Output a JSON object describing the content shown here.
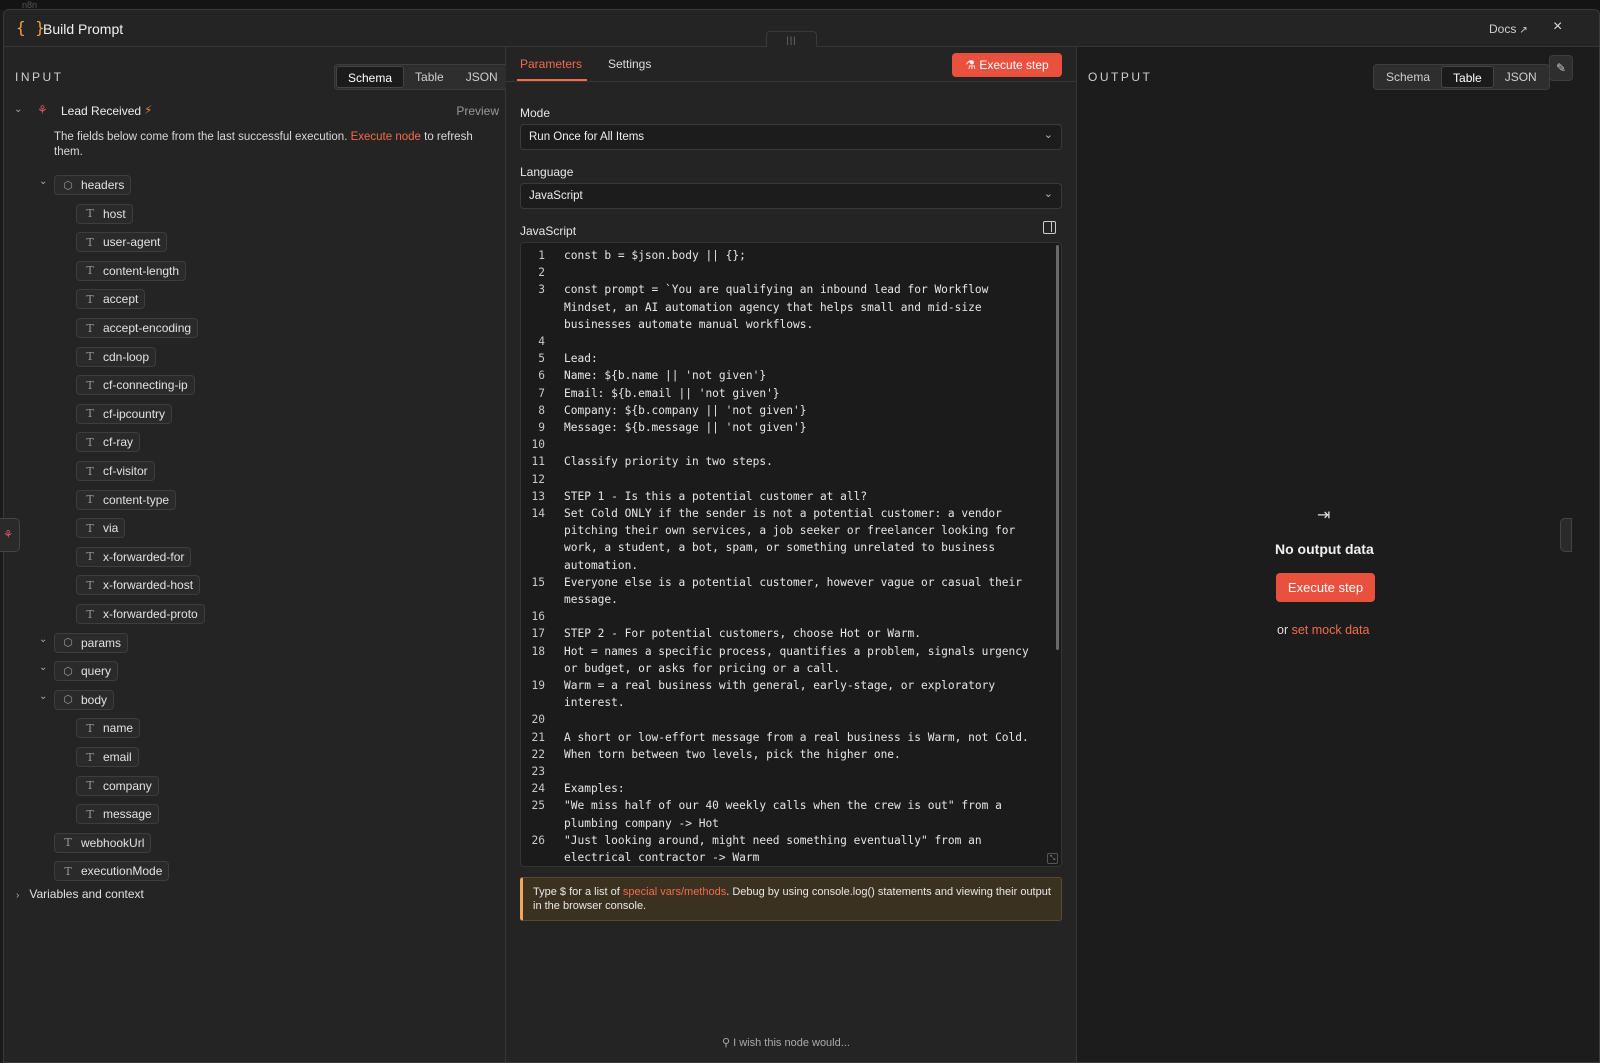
{
  "header": {
    "title": "Build Prompt",
    "docs_label": "Docs",
    "close": "×",
    "drag": "|||"
  },
  "input_panel": {
    "label": "INPUT",
    "views": [
      "Schema",
      "Table",
      "JSON"
    ],
    "active_view": "Schema",
    "node_name": "Lead Received",
    "preview": "Preview",
    "notice_pre": "The fields below come from the last successful execution.",
    "notice_link": "Execute node",
    "notice_post": "to refresh them.",
    "fields": [
      {
        "label": "headers",
        "type": "object",
        "depth": 1,
        "expanded": true
      },
      {
        "label": "host",
        "type": "text",
        "depth": 2
      },
      {
        "label": "user-agent",
        "type": "text",
        "depth": 2
      },
      {
        "label": "content-length",
        "type": "text",
        "depth": 2
      },
      {
        "label": "accept",
        "type": "text",
        "depth": 2
      },
      {
        "label": "accept-encoding",
        "type": "text",
        "depth": 2
      },
      {
        "label": "cdn-loop",
        "type": "text",
        "depth": 2
      },
      {
        "label": "cf-connecting-ip",
        "type": "text",
        "depth": 2
      },
      {
        "label": "cf-ipcountry",
        "type": "text",
        "depth": 2
      },
      {
        "label": "cf-ray",
        "type": "text",
        "depth": 2
      },
      {
        "label": "cf-visitor",
        "type": "text",
        "depth": 2
      },
      {
        "label": "content-type",
        "type": "text",
        "depth": 2
      },
      {
        "label": "via",
        "type": "text",
        "depth": 2
      },
      {
        "label": "x-forwarded-for",
        "type": "text",
        "depth": 2
      },
      {
        "label": "x-forwarded-host",
        "type": "text",
        "depth": 2
      },
      {
        "label": "x-forwarded-proto",
        "type": "text",
        "depth": 2
      },
      {
        "label": "params",
        "type": "object",
        "depth": 1,
        "expanded": true
      },
      {
        "label": "query",
        "type": "object",
        "depth": 1,
        "expanded": true
      },
      {
        "label": "body",
        "type": "object",
        "depth": 1,
        "expanded": true
      },
      {
        "label": "name",
        "type": "text",
        "depth": 2
      },
      {
        "label": "email",
        "type": "text",
        "depth": 2
      },
      {
        "label": "company",
        "type": "text",
        "depth": 2
      },
      {
        "label": "message",
        "type": "text",
        "depth": 2
      },
      {
        "label": "webhookUrl",
        "type": "text",
        "depth": 1
      },
      {
        "label": "executionMode",
        "type": "text",
        "depth": 1
      }
    ],
    "variables_label": "Variables and context"
  },
  "params_panel": {
    "tabs": [
      "Parameters",
      "Settings"
    ],
    "active_tab": "Parameters",
    "execute_label": "Execute step",
    "mode_label": "Mode",
    "mode_value": "Run Once for All Items",
    "language_label": "Language",
    "language_value": "JavaScript",
    "code_label": "JavaScript",
    "code_lines": [
      {
        "n": "1",
        "text": "const b = $json.body || {};"
      },
      {
        "n": "2",
        "text": ""
      },
      {
        "n": "3",
        "text": "const prompt = `You are qualifying an inbound lead for Workflow"
      },
      {
        "n": "",
        "text": "Mindset, an AI automation agency that helps small and mid-size"
      },
      {
        "n": "",
        "text": "businesses automate manual workflows."
      },
      {
        "n": "4",
        "text": ""
      },
      {
        "n": "5",
        "text": "Lead:"
      },
      {
        "n": "6",
        "text": "Name: ${b.name || 'not given'}"
      },
      {
        "n": "7",
        "text": "Email: ${b.email || 'not given'}"
      },
      {
        "n": "8",
        "text": "Company: ${b.company || 'not given'}"
      },
      {
        "n": "9",
        "text": "Message: ${b.message || 'not given'}"
      },
      {
        "n": "10",
        "text": ""
      },
      {
        "n": "11",
        "text": "Classify priority in two steps."
      },
      {
        "n": "12",
        "text": ""
      },
      {
        "n": "13",
        "text": "STEP 1 - Is this a potential customer at all?"
      },
      {
        "n": "14",
        "text": "Set Cold ONLY if the sender is not a potential customer: a vendor"
      },
      {
        "n": "",
        "text": "pitching their own services, a job seeker or freelancer looking for"
      },
      {
        "n": "",
        "text": "work, a student, a bot, spam, or something unrelated to business"
      },
      {
        "n": "",
        "text": "automation."
      },
      {
        "n": "15",
        "text": "Everyone else is a potential customer, however vague or casual their"
      },
      {
        "n": "",
        "text": "message."
      },
      {
        "n": "16",
        "text": ""
      },
      {
        "n": "17",
        "text": "STEP 2 - For potential customers, choose Hot or Warm."
      },
      {
        "n": "18",
        "text": "Hot = names a specific process, quantifies a problem, signals urgency"
      },
      {
        "n": "",
        "text": "or budget, or asks for pricing or a call."
      },
      {
        "n": "19",
        "text": "Warm = a real business with general, early-stage, or exploratory"
      },
      {
        "n": "",
        "text": "interest."
      },
      {
        "n": "20",
        "text": ""
      },
      {
        "n": "21",
        "text": "A short or low-effort message from a real business is Warm, not Cold."
      },
      {
        "n": "22",
        "text": "When torn between two levels, pick the higher one."
      },
      {
        "n": "23",
        "text": ""
      },
      {
        "n": "24",
        "text": "Examples:"
      },
      {
        "n": "25",
        "text": "\"We miss half of our 40 weekly calls when the crew is out\" from a"
      },
      {
        "n": "",
        "text": "plumbing company -> Hot"
      },
      {
        "n": "26",
        "text": "\"Just looking around, might need something eventually\" from an"
      },
      {
        "n": "",
        "text": "electrical contractor -> Warm"
      }
    ],
    "hint_pre": "Type $ for a list of",
    "hint_link": "special vars/methods",
    "hint_post": ". Debug by using console.log() statements and viewing their output in the browser console.",
    "wish": "I wish this node would..."
  },
  "output_panel": {
    "label": "OUTPUT",
    "views": [
      "Schema",
      "Table",
      "JSON"
    ],
    "active_view": "Table",
    "empty_title": "No output data",
    "execute_label": "Execute step",
    "mock_pre": "or",
    "mock_link": "set mock data"
  },
  "colors": {
    "accent": "#e9513e",
    "link": "#f26b4a",
    "icon_brace": "#f29f45"
  }
}
